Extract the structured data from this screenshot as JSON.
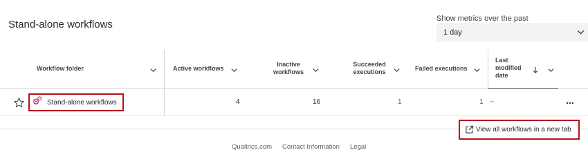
{
  "page": {
    "title": "Stand-alone workflows"
  },
  "metrics": {
    "label": "Show metrics over the past",
    "selected": "1 day"
  },
  "table": {
    "headers": {
      "folder": "Workflow folder",
      "active": "Active workflows",
      "inactive_line1": "Inactive",
      "inactive_line2": "workflows",
      "succeeded_line1": "Succeeded",
      "succeeded_line2": "executions",
      "failed": "Failed executions",
      "modified_line1": "Last",
      "modified_line2": "modified",
      "modified_line3": "date"
    },
    "rows": [
      {
        "folder": "Stand-alone workflows",
        "active": "4",
        "inactive": "16",
        "succeeded": "1",
        "failed": "1",
        "modified": "--",
        "more": "..."
      }
    ]
  },
  "actions": {
    "view_all": "View all workflows in a new tab"
  },
  "footer": {
    "links": [
      "Qualtrics.com",
      "Contact Information",
      "Legal"
    ]
  },
  "colors": {
    "highlight_border": "#b5121b",
    "succeeded_text": "#2e7d32",
    "failed_text": "#c62828",
    "folder_icon": "#c4238f"
  }
}
